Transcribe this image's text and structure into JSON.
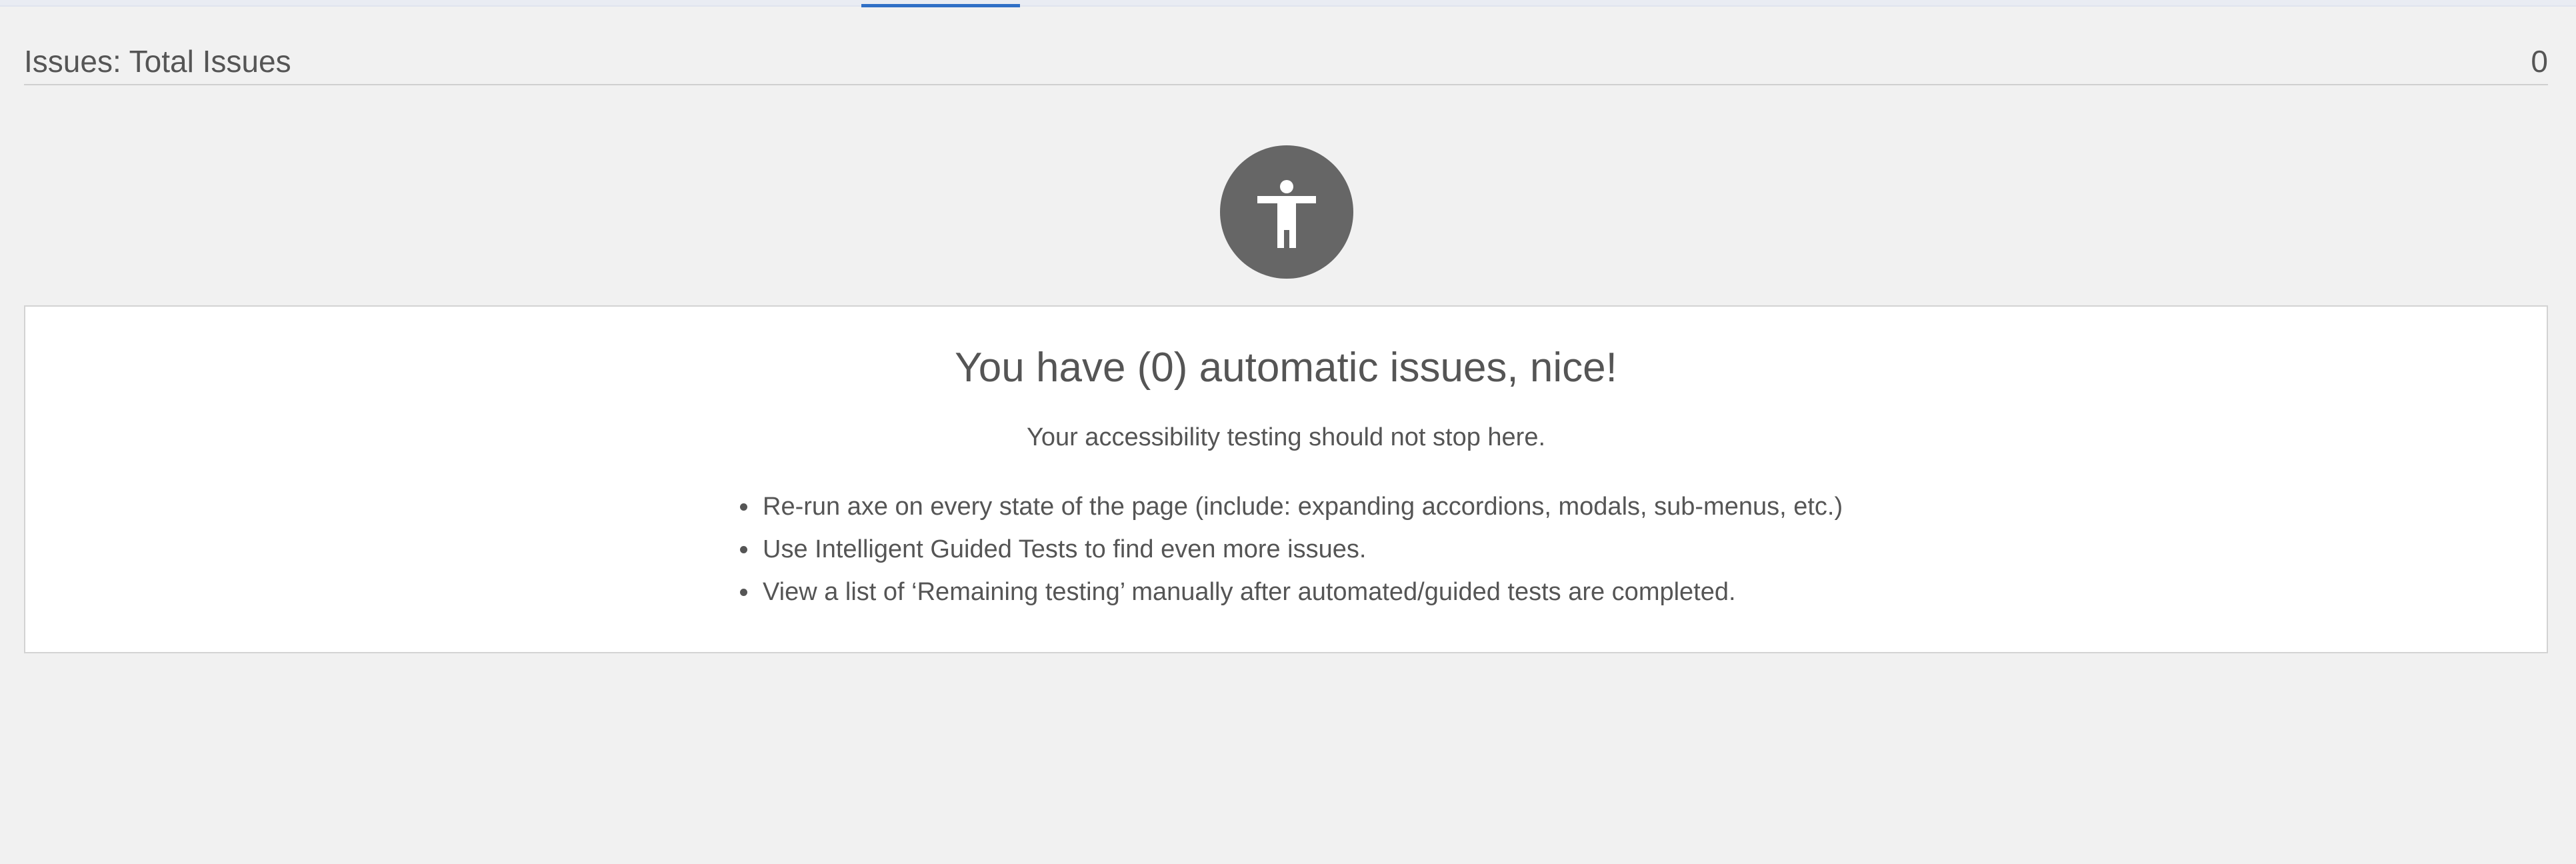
{
  "header": {
    "title": "Issues: Total Issues",
    "count": "0"
  },
  "icon": {
    "name": "accessibility-icon"
  },
  "summary": {
    "heading": "You have (0) automatic issues, nice!",
    "subtext": "Your accessibility testing should not stop here.",
    "tips": [
      "Re-run axe on every state of the page (include: expanding accordions, modals, sub-menus, etc.)",
      "Use Intelligent Guided Tests to find even more issues.",
      "View a list of ‘Remaining testing’ manually after automated/guided tests are completed."
    ]
  },
  "colors": {
    "accent": "#2f6fc6",
    "badge": "#666666",
    "background": "#f1f1f1",
    "card": "#ffffff",
    "text": "#555555"
  }
}
